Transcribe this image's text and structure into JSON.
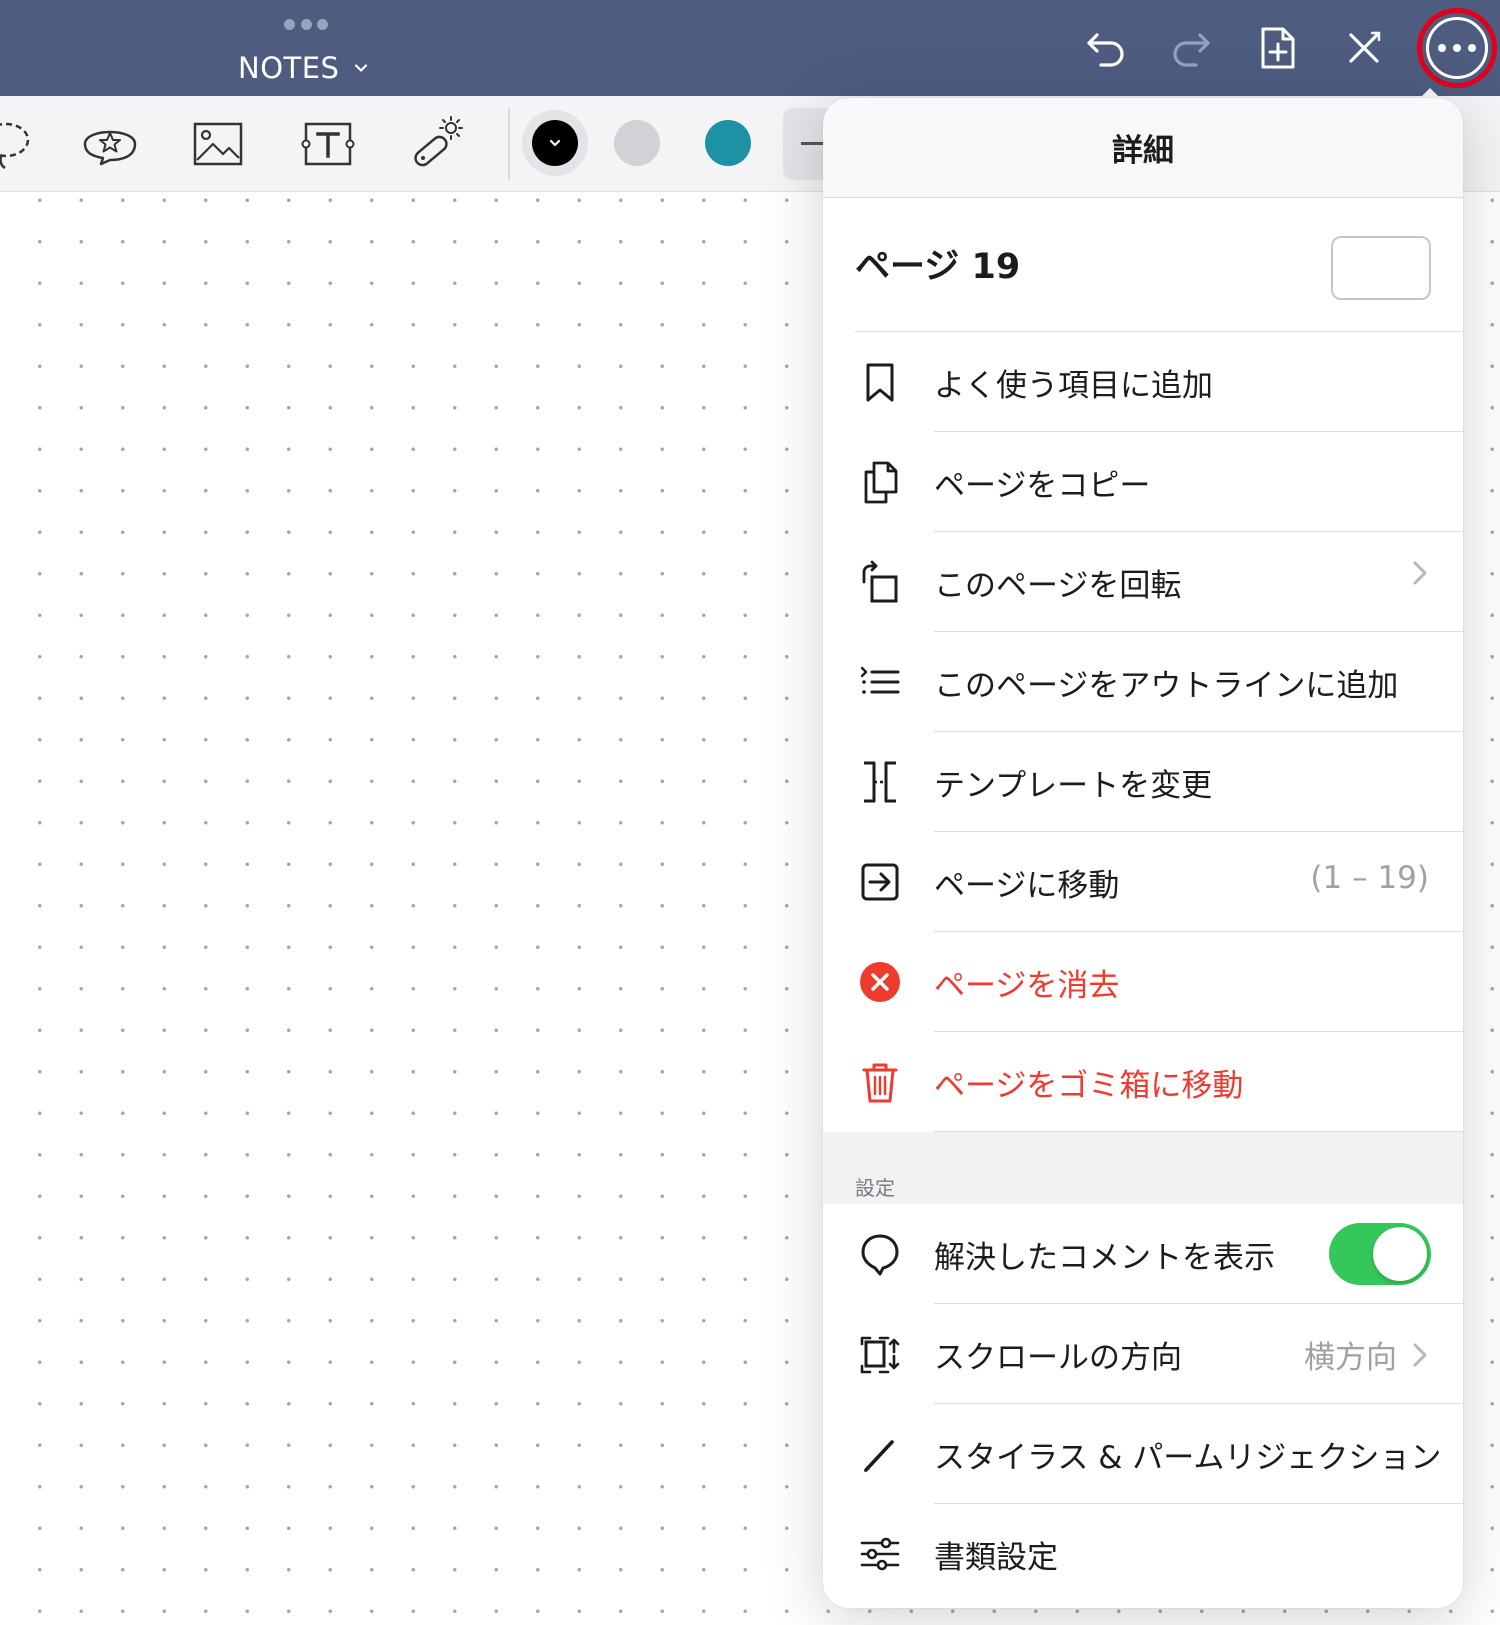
{
  "navbar": {
    "title": "NOTES",
    "icons": [
      "grabber-icon",
      "chevron-down-icon",
      "undo-icon",
      "redo-icon",
      "add-page-icon",
      "close-tools-icon",
      "more-icon"
    ]
  },
  "toolbar": {
    "tools": [
      "lasso-icon",
      "shape-icon",
      "image-icon",
      "text-box-icon",
      "laser-pointer-icon"
    ],
    "colors": [
      "#000000",
      "#d2d2d6",
      "#1d92a5"
    ]
  },
  "popover": {
    "title": "詳細",
    "page_label": "ページ 19",
    "page_field_value": "",
    "items": [
      {
        "label": "よく使う項目に追加",
        "icon": "bookmark-icon"
      },
      {
        "label": "ページをコピー",
        "icon": "copy-icon"
      },
      {
        "label": "このページを回転",
        "icon": "rotate-icon"
      },
      {
        "label": "このページをアウトラインに追加",
        "icon": "outline-icon"
      },
      {
        "label": "テンプレートを変更",
        "icon": "template-icon"
      },
      {
        "label": "ページに移動",
        "icon": "go-to-page-icon",
        "trail": "(1 – 19)"
      },
      {
        "label": "ページを消去",
        "icon": "clear-icon"
      },
      {
        "label": "ページをゴミ箱に移動",
        "icon": "trash-icon"
      }
    ],
    "settings_label": "設定",
    "settings": [
      {
        "label": "解決したコメントを表示",
        "icon": "comment-icon",
        "toggle": true
      },
      {
        "label": "スクロールの方向",
        "icon": "scroll-direction-icon",
        "trail": "横方向"
      },
      {
        "label": "スタイラス & パームリジェクション",
        "icon": "stylus-icon"
      },
      {
        "label": "書類設定",
        "icon": "sliders-icon"
      }
    ]
  }
}
